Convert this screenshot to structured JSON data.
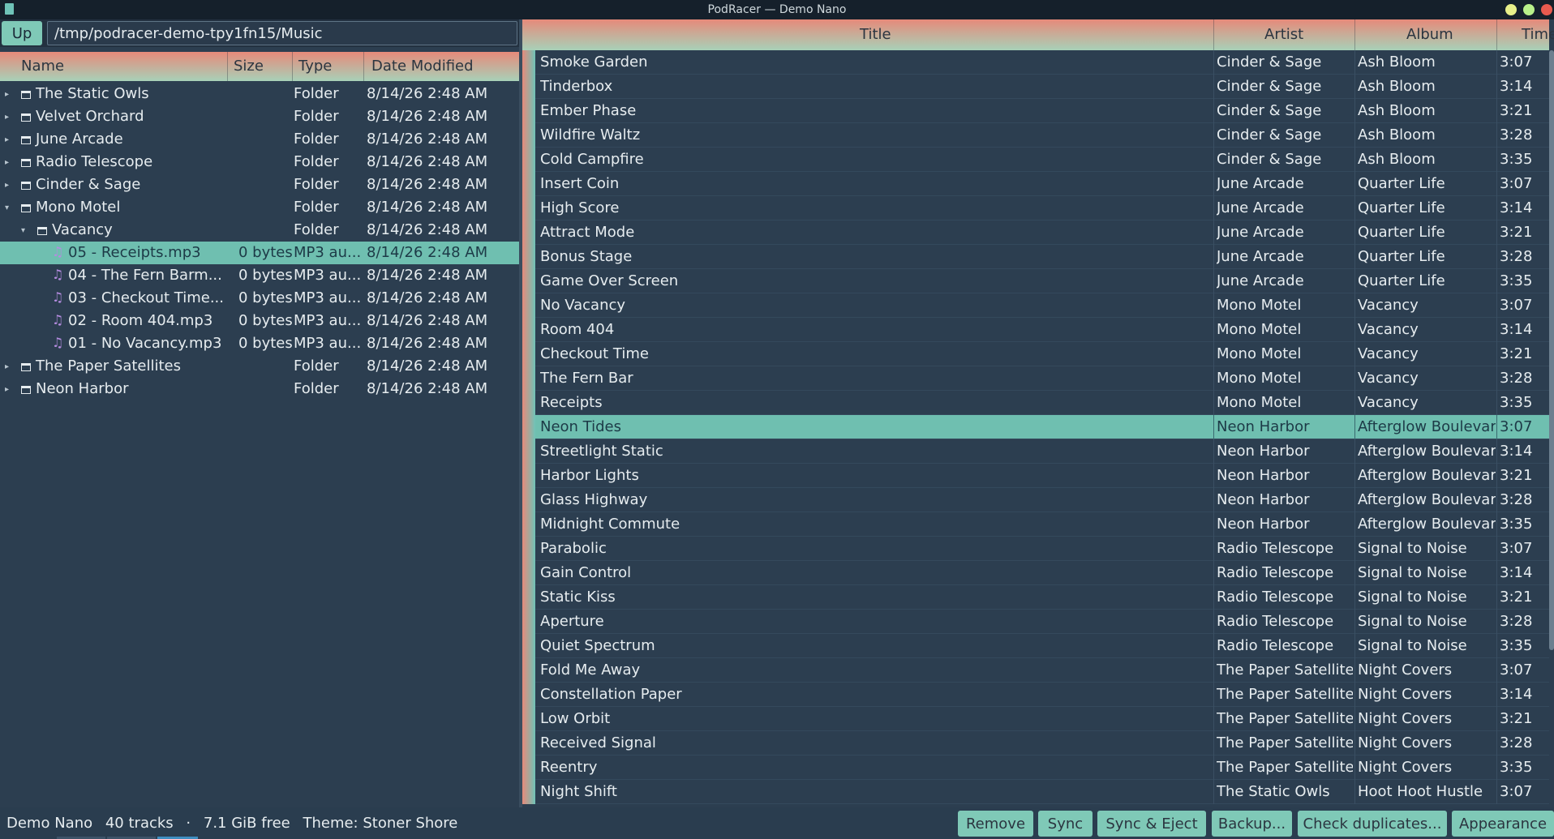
{
  "window": {
    "title": "PodRacer — Demo Nano"
  },
  "pathbar": {
    "up_label": "Up",
    "path": "/tmp/podracer-demo-tpy1fn15/Music"
  },
  "file_browser": {
    "columns": [
      "Name",
      "Size",
      "Type",
      "Date Modified"
    ],
    "rows": [
      {
        "name": "The Static Owls",
        "size": "",
        "type": "Folder",
        "date": "8/14/26 2:48 AM",
        "kind": "folder",
        "arrow": "▸",
        "depth": 0
      },
      {
        "name": "Velvet Orchard",
        "size": "",
        "type": "Folder",
        "date": "8/14/26 2:48 AM",
        "kind": "folder",
        "arrow": "▸",
        "depth": 0
      },
      {
        "name": "June Arcade",
        "size": "",
        "type": "Folder",
        "date": "8/14/26 2:48 AM",
        "kind": "folder",
        "arrow": "▸",
        "depth": 0
      },
      {
        "name": "Radio Telescope",
        "size": "",
        "type": "Folder",
        "date": "8/14/26 2:48 AM",
        "kind": "folder",
        "arrow": "▸",
        "depth": 0
      },
      {
        "name": "Cinder & Sage",
        "size": "",
        "type": "Folder",
        "date": "8/14/26 2:48 AM",
        "kind": "folder",
        "arrow": "▸",
        "depth": 0
      },
      {
        "name": "Mono Motel",
        "size": "",
        "type": "Folder",
        "date": "8/14/26 2:48 AM",
        "kind": "folder",
        "arrow": "▾",
        "depth": 0
      },
      {
        "name": "Vacancy",
        "size": "",
        "type": "Folder",
        "date": "8/14/26 2:48 AM",
        "kind": "folder",
        "arrow": "▾",
        "depth": 1
      },
      {
        "name": "05 - Receipts.mp3",
        "size": "0 bytes",
        "type": "MP3 au...",
        "date": "8/14/26 2:48 AM",
        "kind": "file",
        "arrow": "",
        "depth": 2,
        "selected": true
      },
      {
        "name": "04 - The Fern Barm...",
        "size": "0 bytes",
        "type": "MP3 au...",
        "date": "8/14/26 2:48 AM",
        "kind": "file",
        "arrow": "",
        "depth": 2
      },
      {
        "name": "03 - Checkout Time...",
        "size": "0 bytes",
        "type": "MP3 au...",
        "date": "8/14/26 2:48 AM",
        "kind": "file",
        "arrow": "",
        "depth": 2
      },
      {
        "name": "02 - Room 404.mp3",
        "size": "0 bytes",
        "type": "MP3 au...",
        "date": "8/14/26 2:48 AM",
        "kind": "file",
        "arrow": "",
        "depth": 2
      },
      {
        "name": "01 - No Vacancy.mp3",
        "size": "0 bytes",
        "type": "MP3 au...",
        "date": "8/14/26 2:48 AM",
        "kind": "file",
        "arrow": "",
        "depth": 2
      },
      {
        "name": "The Paper Satellites",
        "size": "",
        "type": "Folder",
        "date": "8/14/26 2:48 AM",
        "kind": "folder",
        "arrow": "▸",
        "depth": 0
      },
      {
        "name": "Neon Harbor",
        "size": "",
        "type": "Folder",
        "date": "8/14/26 2:48 AM",
        "kind": "folder",
        "arrow": "▸",
        "depth": 0
      }
    ]
  },
  "tracks": {
    "columns": [
      "Title",
      "Artist",
      "Album",
      "Time"
    ],
    "rows": [
      {
        "title": "Smoke Garden",
        "artist": "Cinder & Sage",
        "album": "Ash Bloom",
        "time": "3:07"
      },
      {
        "title": "Tinderbox",
        "artist": "Cinder & Sage",
        "album": "Ash Bloom",
        "time": "3:14"
      },
      {
        "title": "Ember Phase",
        "artist": "Cinder & Sage",
        "album": "Ash Bloom",
        "time": "3:21"
      },
      {
        "title": "Wildfire Waltz",
        "artist": "Cinder & Sage",
        "album": "Ash Bloom",
        "time": "3:28"
      },
      {
        "title": "Cold Campfire",
        "artist": "Cinder & Sage",
        "album": "Ash Bloom",
        "time": "3:35"
      },
      {
        "title": "Insert Coin",
        "artist": "June Arcade",
        "album": "Quarter Life",
        "time": "3:07"
      },
      {
        "title": "High Score",
        "artist": "June Arcade",
        "album": "Quarter Life",
        "time": "3:14"
      },
      {
        "title": "Attract Mode",
        "artist": "June Arcade",
        "album": "Quarter Life",
        "time": "3:21"
      },
      {
        "title": "Bonus Stage",
        "artist": "June Arcade",
        "album": "Quarter Life",
        "time": "3:28"
      },
      {
        "title": "Game Over Screen",
        "artist": "June Arcade",
        "album": "Quarter Life",
        "time": "3:35"
      },
      {
        "title": "No Vacancy",
        "artist": "Mono Motel",
        "album": "Vacancy",
        "time": "3:07"
      },
      {
        "title": "Room 404",
        "artist": "Mono Motel",
        "album": "Vacancy",
        "time": "3:14"
      },
      {
        "title": "Checkout Time",
        "artist": "Mono Motel",
        "album": "Vacancy",
        "time": "3:21"
      },
      {
        "title": "The Fern Bar",
        "artist": "Mono Motel",
        "album": "Vacancy",
        "time": "3:28"
      },
      {
        "title": "Receipts",
        "artist": "Mono Motel",
        "album": "Vacancy",
        "time": "3:35"
      },
      {
        "title": "Neon Tides",
        "artist": "Neon Harbor",
        "album": "Afterglow Boulevard",
        "time": "3:07",
        "selected": true
      },
      {
        "title": "Streetlight Static",
        "artist": "Neon Harbor",
        "album": "Afterglow Boulevard",
        "time": "3:14"
      },
      {
        "title": "Harbor Lights",
        "artist": "Neon Harbor",
        "album": "Afterglow Boulevard",
        "time": "3:21"
      },
      {
        "title": "Glass Highway",
        "artist": "Neon Harbor",
        "album": "Afterglow Boulevard",
        "time": "3:28"
      },
      {
        "title": "Midnight Commute",
        "artist": "Neon Harbor",
        "album": "Afterglow Boulevard",
        "time": "3:35"
      },
      {
        "title": "Parabolic",
        "artist": "Radio Telescope",
        "album": "Signal to Noise",
        "time": "3:07"
      },
      {
        "title": "Gain Control",
        "artist": "Radio Telescope",
        "album": "Signal to Noise",
        "time": "3:14"
      },
      {
        "title": "Static Kiss",
        "artist": "Radio Telescope",
        "album": "Signal to Noise",
        "time": "3:21"
      },
      {
        "title": "Aperture",
        "artist": "Radio Telescope",
        "album": "Signal to Noise",
        "time": "3:28"
      },
      {
        "title": "Quiet Spectrum",
        "artist": "Radio Telescope",
        "album": "Signal to Noise",
        "time": "3:35"
      },
      {
        "title": "Fold Me Away",
        "artist": "The Paper Satellites",
        "album": "Night Covers",
        "time": "3:07"
      },
      {
        "title": "Constellation Paper",
        "artist": "The Paper Satellites",
        "album": "Night Covers",
        "time": "3:14"
      },
      {
        "title": "Low Orbit",
        "artist": "The Paper Satellites",
        "album": "Night Covers",
        "time": "3:21"
      },
      {
        "title": "Received Signal",
        "artist": "The Paper Satellites",
        "album": "Night Covers",
        "time": "3:28"
      },
      {
        "title": "Reentry",
        "artist": "The Paper Satellites",
        "album": "Night Covers",
        "time": "3:35"
      },
      {
        "title": "Night Shift",
        "artist": "The Static Owls",
        "album": "Hoot Hoot Hustle",
        "time": "3:07"
      }
    ]
  },
  "status": {
    "device": "Demo Nano",
    "tracks": "40 tracks",
    "sep": "·",
    "free": "7.1 GiB free",
    "theme": "Theme: Stoner Shore"
  },
  "buttons": {
    "remove": "Remove",
    "sync": "Sync",
    "sync_eject": "Sync & Eject",
    "backup": "Backup...",
    "check_duplicates": "Check duplicates...",
    "appearance": "Appearance"
  },
  "colors": {
    "accent": "#7fc9b7",
    "selection": "#6fbfb0",
    "header_top": "#e68a7a",
    "header_bottom": "#a8d1b8",
    "background": "#2c3e50"
  }
}
